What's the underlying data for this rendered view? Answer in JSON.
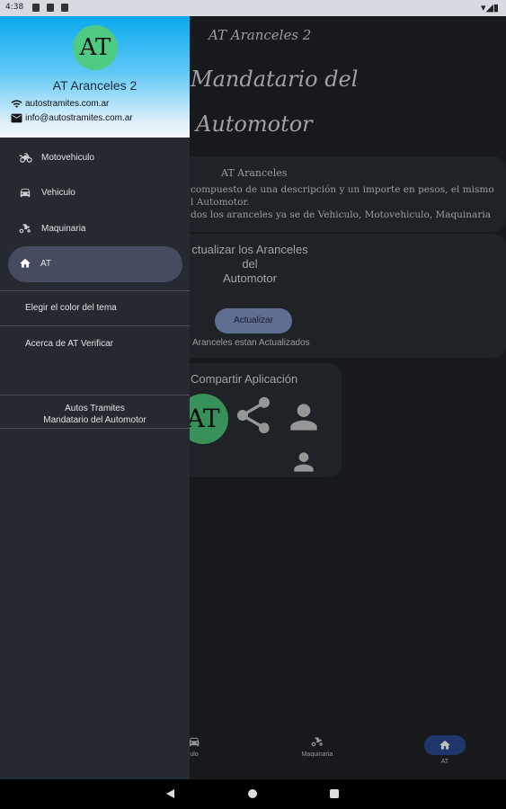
{
  "status_bar": {
    "time": "4:38"
  },
  "main": {
    "title_small": "AT Aranceles 2",
    "title_big_line1": "Mandatario del",
    "title_big_line2": "Automotor",
    "info_card": {
      "heading": "AT Aranceles",
      "line1": "compuesto de una descripción y un importe en pesos, el mismo",
      "line2": "l Automotor.",
      "line3": "dos los aranceles ya se de Vehiculo, Motovehiculo, Maquinaria"
    },
    "update_card": {
      "title_l1": "ctualizar los Aranceles",
      "title_l2": "del",
      "title_l3": "Automotor",
      "button": "Actualizar",
      "status": "Aranceles estan Actualizados"
    },
    "share_card": {
      "title": "Compartir Aplicación",
      "logo_text": "AT"
    }
  },
  "bottom_nav": [
    {
      "label": "ulo",
      "icon": "car-icon"
    },
    {
      "label": "Maquinaria",
      "icon": "tractor-icon"
    },
    {
      "label": "AT",
      "icon": "home-icon",
      "selected": true
    }
  ],
  "drawer": {
    "logo_text": "AT",
    "app_name": "AT Aranceles 2",
    "website": "autostramites.com.ar",
    "email": "info@autostramites.com.ar",
    "items": [
      {
        "label": "Motovehiculo",
        "icon": "motorcycle-icon"
      },
      {
        "label": "Vehiculo",
        "icon": "car-icon"
      },
      {
        "label": "Maquinaria",
        "icon": "tractor-icon"
      },
      {
        "label": "AT",
        "icon": "home-icon",
        "selected": true
      }
    ],
    "theme_color": "Elegir el color del tema",
    "about": "Acerca de AT Verificar",
    "footer_line1": "Autos Tramites",
    "footer_line2": "Mandatario del Automotor"
  },
  "colors": {
    "background": "#1f2227",
    "card": "#2a2e34",
    "drawer": "#252a31",
    "selected_item": "#464b60",
    "button": "#7f95c3",
    "logo_green": "#4fca83"
  }
}
